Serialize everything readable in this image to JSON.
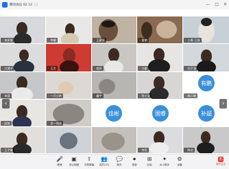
{
  "window": {
    "title": "腾讯会议 82 14",
    "pin_glyph": "▢",
    "minimize": "—",
    "maximize": "□",
    "close": "✕"
  },
  "participants": [
    {
      "name": "张家俊"
    },
    {
      "name": "李耀"
    },
    {
      "name": "王建军"
    },
    {
      "name": "星期"
    },
    {
      "name": "小周-王强"
    },
    {
      "name": "沙漠子"
    },
    {
      "name": "王文"
    },
    {
      "name": "姚亮"
    },
    {
      "name": "亢俊"
    },
    {
      "name": "任子涵"
    },
    {
      "name": "朱德"
    },
    {
      "name": "一只小茶"
    },
    {
      "name": "鑫宇"
    },
    {
      "name": "兔七宝"
    },
    {
      "name": "林二晓"
    },
    {
      "name": "有鹏",
      "avatar_text": "有鹏",
      "color": "#3b8fd9"
    },
    {
      "name": "赵旭"
    },
    {
      "name": "吴一同学"
    },
    {
      "name": "佳彬",
      "avatar_text": "佳彬",
      "color": "#3b8fd9"
    },
    {
      "name": "国睿",
      "avatar_text": "国睿",
      "color": "#3b8fd9"
    },
    {
      "name": "补超",
      "avatar_text": "补超",
      "color": "#3b8fd9"
    },
    {
      "name": "王子谦"
    },
    {
      "name": "李亮"
    },
    {
      "name": "陈浩"
    }
  ],
  "nav": {
    "prev": "‹",
    "next": "›"
  },
  "toolbar": {
    "buttons": [
      {
        "label": "静音",
        "icon": "🎤"
      },
      {
        "label": "停止视频",
        "icon": "▣"
      },
      {
        "label": "共享屏幕",
        "icon": "⇪"
      },
      {
        "label": "成员(34)",
        "icon": "👥"
      },
      {
        "label": "聊天",
        "icon": "💬"
      },
      {
        "label": "录制",
        "icon": "⏺"
      },
      {
        "label": "应用",
        "icon": "⊞"
      },
      {
        "label": "AI小助手",
        "icon": "✦"
      },
      {
        "label": "设置",
        "icon": "⚙"
      }
    ],
    "end_label": "离开会议",
    "end_icon": "E"
  },
  "colors": {
    "end": "#e8453c",
    "avatar": "#3b8fd9"
  }
}
